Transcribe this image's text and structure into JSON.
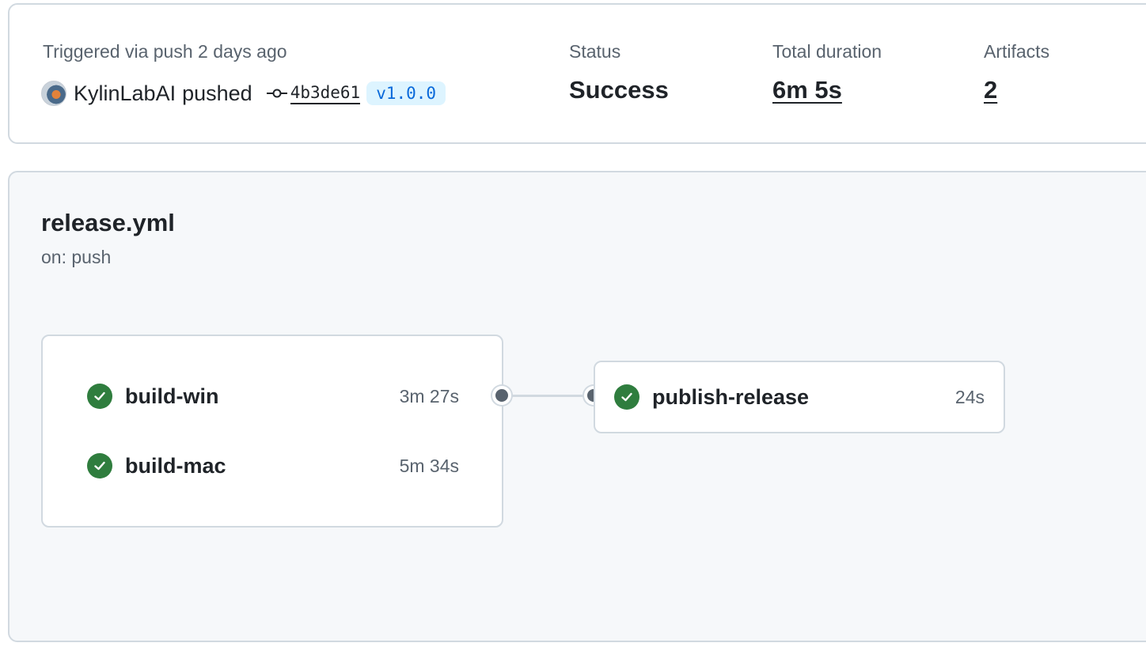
{
  "summary": {
    "trigger_text": "Triggered via push 2 days ago",
    "actor": "KylinLabAI",
    "action": "pushed",
    "commit_sha": "4b3de61",
    "tag": "v1.0.0",
    "status_label": "Status",
    "status_value": "Success",
    "duration_label": "Total duration",
    "duration_value": "6m 5s",
    "artifacts_label": "Artifacts",
    "artifacts_value": "2"
  },
  "workflow": {
    "file": "release.yml",
    "trigger": "on: push",
    "jobs": [
      {
        "name": "build-win",
        "duration": "3m 27s",
        "status": "success"
      },
      {
        "name": "build-mac",
        "duration": "5m 34s",
        "status": "success"
      },
      {
        "name": "publish-release",
        "duration": "24s",
        "status": "success"
      }
    ]
  },
  "colors": {
    "success": "#2f7d3e",
    "tag_text": "#0969da",
    "tag_bg": "#ddf4ff",
    "border": "#d1d9e0"
  },
  "icons": {
    "avatar": "avatar-image",
    "commit": "git-commit-icon",
    "job_status": "check-circle-icon"
  }
}
